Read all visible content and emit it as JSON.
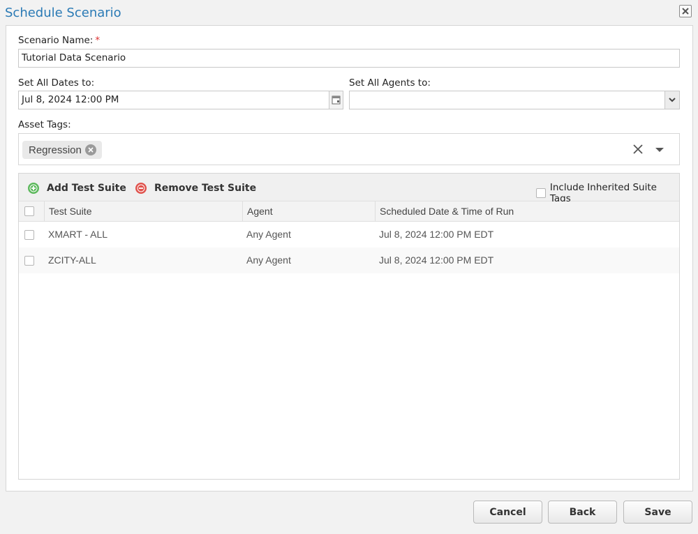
{
  "dialog": {
    "title": "Schedule Scenario",
    "close_icon": "close-icon"
  },
  "form": {
    "scenario_name_label": "Scenario Name:",
    "required_mark": "*",
    "scenario_name_value": "Tutorial Data Scenario",
    "set_dates_label": "Set All Dates to:",
    "set_dates_value": "Jul 8, 2024 12:00 PM",
    "set_agents_label": "Set All Agents to:",
    "set_agents_value": "",
    "asset_tags_label": "Asset Tags:",
    "tags": [
      "Regression"
    ]
  },
  "grid": {
    "add_label": "Add Test Suite",
    "remove_label": "Remove Test Suite",
    "include_inherited_label": "Include Inherited Suite Tags",
    "columns": [
      "Test Suite",
      "Agent",
      "Scheduled Date & Time of Run"
    ],
    "rows": [
      {
        "suite": "XMART - ALL",
        "agent": "Any Agent",
        "datetime": "Jul 8, 2024 12:00 PM EDT"
      },
      {
        "suite": "ZCITY-ALL",
        "agent": "Any Agent",
        "datetime": "Jul 8, 2024 12:00 PM EDT"
      }
    ]
  },
  "footer": {
    "cancel_label": "Cancel",
    "back_label": "Back",
    "save_label": "Save"
  },
  "colors": {
    "title": "#2a7ab5",
    "add_icon": "#5cb85c",
    "remove_icon": "#e0524c",
    "required": "#dd3333"
  }
}
